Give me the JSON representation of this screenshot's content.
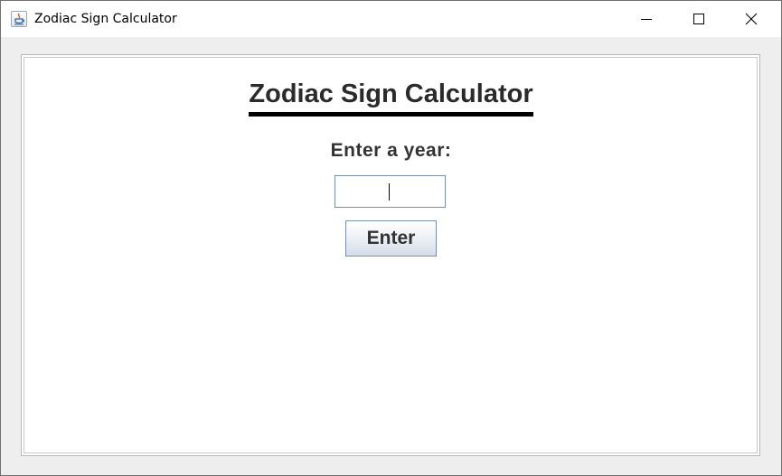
{
  "window": {
    "title": "Zodiac Sign Calculator",
    "icon": "java-cup-icon",
    "controls": [
      "minimize",
      "maximize",
      "close"
    ]
  },
  "main": {
    "heading": "Zodiac Sign Calculator",
    "prompt": "Enter a year:",
    "year_input": {
      "value": "",
      "placeholder": ""
    },
    "enter_button_label": "Enter"
  },
  "colors": {
    "heading_underline": "#000000",
    "text": "#333333",
    "input_border": "#7a8ea6"
  }
}
